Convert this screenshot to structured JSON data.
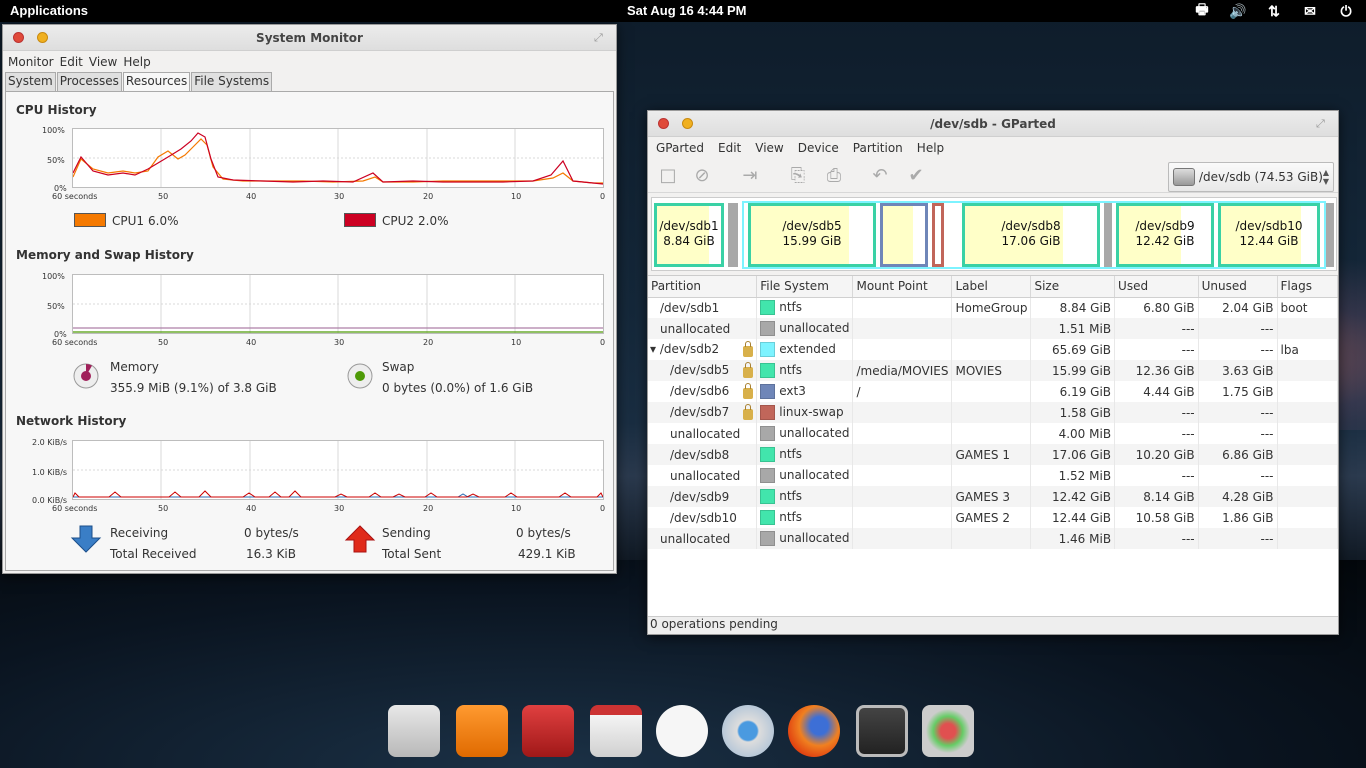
{
  "top_panel": {
    "applications": "Applications",
    "clock": "Sat Aug 16  4:44 PM"
  },
  "sysmon": {
    "title": "System Monitor",
    "menu": [
      "Monitor",
      "Edit",
      "View",
      "Help"
    ],
    "tabs": [
      "System",
      "Processes",
      "Resources",
      "File Systems"
    ],
    "cpu": {
      "title": "CPU History",
      "y_ticks": [
        "100%",
        "50%",
        "0%"
      ],
      "x_ticks": [
        "60 seconds",
        "50",
        "40",
        "30",
        "20",
        "10",
        "0"
      ],
      "cpu1_label": "CPU1",
      "cpu1_value": "6.0%",
      "cpu1_color": "#f57900",
      "cpu2_label": "CPU2",
      "cpu2_value": "2.0%",
      "cpu2_color": "#cc0022"
    },
    "memory": {
      "title": "Memory and Swap History",
      "y_ticks": [
        "100%",
        "50%",
        "0%"
      ],
      "x_ticks": [
        "60 seconds",
        "50",
        "40",
        "30",
        "20",
        "10",
        "0"
      ],
      "memory_label": "Memory",
      "memory_value": "355.9 MiB (9.1%) of 3.8 GiB",
      "swap_label": "Swap",
      "swap_value": "0 bytes (0.0%) of 1.6 GiB"
    },
    "network": {
      "title": "Network History",
      "y_ticks": [
        "2.0 KiB/s",
        "1.0 KiB/s",
        "0.0 KiB/s"
      ],
      "x_ticks": [
        "60 seconds",
        "50",
        "40",
        "30",
        "20",
        "10",
        "0"
      ],
      "receiving_label": "Receiving",
      "receiving_value": "0 bytes/s",
      "total_received_label": "Total Received",
      "total_received_value": "16.3 KiB",
      "sending_label": "Sending",
      "sending_value": "0 bytes/s",
      "total_sent_label": "Total Sent",
      "total_sent_value": "429.1 KiB"
    }
  },
  "gparted": {
    "title": "/dev/sdb - GParted",
    "menu": [
      "GParted",
      "Edit",
      "View",
      "Device",
      "Partition",
      "Help"
    ],
    "device_selector": "/dev/sdb  (74.53 GiB)",
    "map": [
      {
        "name": "/dev/sdb1",
        "size": "8.84 GiB"
      },
      {
        "name": "/dev/sdb5",
        "size": "15.99 GiB"
      },
      {
        "name": "/dev/sdb8",
        "size": "17.06 GiB"
      },
      {
        "name": "/dev/sdb9",
        "size": "12.42 GiB"
      },
      {
        "name": "/dev/sdb10",
        "size": "12.44 GiB"
      }
    ],
    "columns": [
      "Partition",
      "File System",
      "Mount Point",
      "Label",
      "Size",
      "Used",
      "Unused",
      "Flags"
    ],
    "rows": [
      {
        "partition": "/dev/sdb1",
        "fs": "ntfs",
        "fs_color": "#42e5ac",
        "mount": "",
        "label": "HomeGroup",
        "size": "8.84 GiB",
        "used": "6.80 GiB",
        "unused": "2.04 GiB",
        "flags": "boot"
      },
      {
        "partition": "unallocated",
        "fs": "unallocated",
        "fs_color": "#a8a8a8",
        "mount": "",
        "label": "",
        "size": "1.51 MiB",
        "used": "---",
        "unused": "---",
        "flags": ""
      },
      {
        "partition": "/dev/sdb2",
        "fs": "extended",
        "fs_color": "#7df3ff",
        "mount": "",
        "label": "",
        "size": "65.69 GiB",
        "used": "---",
        "unused": "---",
        "flags": "lba"
      },
      {
        "partition": "/dev/sdb5",
        "fs": "ntfs",
        "fs_color": "#42e5ac",
        "mount": "/media/MOVIES",
        "label": "MOVIES",
        "size": "15.99 GiB",
        "used": "12.36 GiB",
        "unused": "3.63 GiB",
        "flags": ""
      },
      {
        "partition": "/dev/sdb6",
        "fs": "ext3",
        "fs_color": "#6f86b8",
        "mount": "/",
        "label": "",
        "size": "6.19 GiB",
        "used": "4.44 GiB",
        "unused": "1.75 GiB",
        "flags": ""
      },
      {
        "partition": "/dev/sdb7",
        "fs": "linux-swap",
        "fs_color": "#c1665a",
        "mount": "",
        "label": "",
        "size": "1.58 GiB",
        "used": "---",
        "unused": "---",
        "flags": ""
      },
      {
        "partition": "unallocated",
        "fs": "unallocated",
        "fs_color": "#a8a8a8",
        "mount": "",
        "label": "",
        "size": "4.00 MiB",
        "used": "---",
        "unused": "---",
        "flags": ""
      },
      {
        "partition": "/dev/sdb8",
        "fs": "ntfs",
        "fs_color": "#42e5ac",
        "mount": "",
        "label": "GAMES 1",
        "size": "17.06 GiB",
        "used": "10.20 GiB",
        "unused": "6.86 GiB",
        "flags": ""
      },
      {
        "partition": "unallocated",
        "fs": "unallocated",
        "fs_color": "#a8a8a8",
        "mount": "",
        "label": "",
        "size": "1.52 MiB",
        "used": "---",
        "unused": "---",
        "flags": ""
      },
      {
        "partition": "/dev/sdb9",
        "fs": "ntfs",
        "fs_color": "#42e5ac",
        "mount": "",
        "label": "GAMES 3",
        "size": "12.42 GiB",
        "used": "8.14 GiB",
        "unused": "4.28 GiB",
        "flags": ""
      },
      {
        "partition": "/dev/sdb10",
        "fs": "ntfs",
        "fs_color": "#42e5ac",
        "mount": "",
        "label": "GAMES 2",
        "size": "12.44 GiB",
        "used": "10.58 GiB",
        "unused": "1.86 GiB",
        "flags": ""
      },
      {
        "partition": "unallocated",
        "fs": "unallocated",
        "fs_color": "#a8a8a8",
        "mount": "",
        "label": "",
        "size": "1.46 MiB",
        "used": "---",
        "unused": "---",
        "flags": ""
      }
    ],
    "status": "0 operations pending"
  },
  "dock": {
    "items": [
      "home-folder-icon",
      "music-player-icon",
      "video-player-icon",
      "calendar-icon",
      "messaging-icon",
      "chromium-icon",
      "firefox-icon",
      "system-monitor-icon",
      "disk-utility-icon"
    ]
  }
}
